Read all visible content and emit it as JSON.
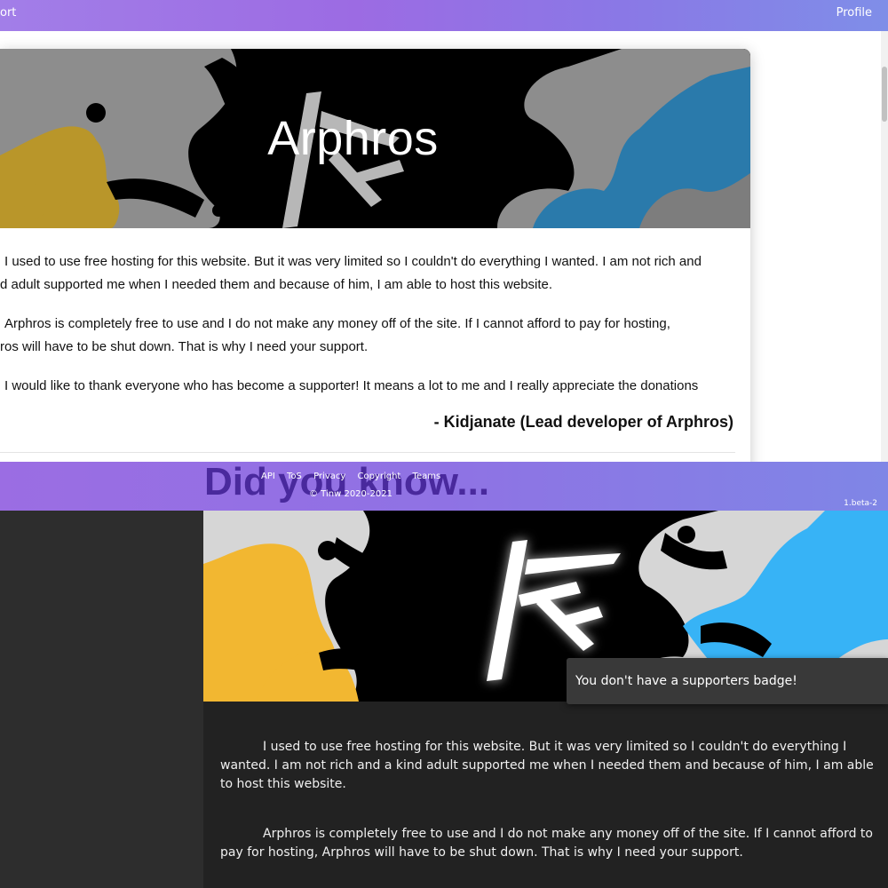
{
  "nav": {
    "left_label": "ort",
    "right_label": "Profile"
  },
  "light_card": {
    "title": "Arphros",
    "paragraphs": [
      [
        "I used to use free hosting for this website. But it was very limited so I couldn't do everything I wanted. I am not rich and",
        "d adult supported me when I needed them and because of him, I am able to host this website."
      ],
      [
        "Arphros is completely free to use and I do not make any money off of the site. If I cannot afford to pay for hosting,",
        "ros will have to be shut down. That is why I need your support."
      ],
      [
        "I would like to thank everyone who has become a supporter! It means a lot to me and I really appreciate the donations"
      ]
    ],
    "signature": "- Kidjanate (Lead developer of Arphros)"
  },
  "footer": {
    "links": [
      "API",
      "ToS",
      "Privacy",
      "Copyright",
      "Teams"
    ],
    "copyright": "© Tinw 2020-2021",
    "version": "1.beta-2",
    "overlay_heading": "Did you know..."
  },
  "dark_card": {
    "tooltip": "You don't have a supporters badge!",
    "paragraphs": [
      "I used to use free hosting for this website. But it was very limited so I couldn't do everything I wanted. I am not rich and a kind adult supported me when I needed them and because of him, I am able to host this website.",
      "Arphros is completely free to use and I do not make any money off of the site. If I cannot afford to pay for hosting, Arphros will have to be shut down. That is why I need your support."
    ]
  },
  "colors": {
    "accent_gradient_start": "#a27ee8",
    "accent_gradient_end": "#7f8ee8",
    "banner_yellow_light": "#b9962a",
    "banner_blue_light": "#2a7aab",
    "banner_yellow_dark": "#f2b731",
    "banner_blue_dark": "#37b3f6",
    "dark_bg": "#222222"
  },
  "icons": [
    "arphros-logo-icon",
    "chevron-down-icon"
  ]
}
